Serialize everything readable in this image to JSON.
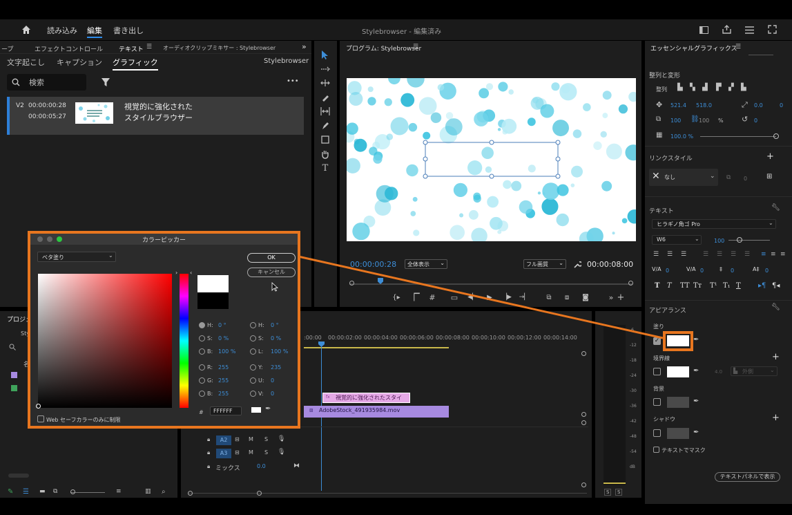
{
  "topbar": {
    "tabs": [
      "読み込み",
      "編集",
      "書き出し"
    ],
    "active_tab": "編集",
    "title": "Stylebrowser - 編集済み"
  },
  "left_panel": {
    "tabs": [
      "ープ",
      "エフェクトコントロール",
      "テキスト",
      "オーディオクリップミキサー : Stylebrowser"
    ],
    "subtabs": [
      "文字起こし",
      "キャプション",
      "グラフィック"
    ],
    "active_subtab": "グラフィック",
    "sequence": "Stylebrowser",
    "search_placeholder": "検索",
    "more": "•••",
    "clip": {
      "track": "V2",
      "in": "00:00:00:28",
      "out": "00:00:05:27",
      "title_line1": "視覚的に強化された",
      "title_line2": "スタイルブラウザー"
    }
  },
  "program": {
    "title": "プログラム: Stylebrowser",
    "menu_glyph": "☰",
    "timecode": "00:00:00:28",
    "fit": "全体表示",
    "quality": "フル画質",
    "duration": "00:00:08:00"
  },
  "timeline": {
    "ruler": [
      ":00:00",
      "00:00:02:00",
      "00:00:04:00",
      "00:00:06:00",
      "00:00:08:00",
      "00:00:10:00",
      "00:00:12:00",
      "00:00:14:00"
    ],
    "graphic_clip": "視覚的に強化されたスタイ",
    "video_clip": "AdobeStock_491935984.mov",
    "tracks": [
      "A2",
      "A3"
    ],
    "mix_label": "ミックス",
    "mix_value": "0.0",
    "meter": [
      "-6",
      "-12",
      "-18",
      "-24",
      "-30",
      "-36",
      "-42",
      "-48",
      "-54",
      "dB"
    ]
  },
  "project": {
    "tab": "プロジェ",
    "item": "Sty",
    "name_header": "名"
  },
  "essential": {
    "title": "エッセンシャルグラフィックス",
    "align_heading": "整列と変形",
    "align_label": "整列",
    "pos_x": "521.4",
    "pos_y": "518.0",
    "anchor_x": "0.0",
    "anchor_y": "0",
    "scale": "100",
    "scale2": "100",
    "scale_pct": "%",
    "rotation": "0",
    "opacity": "100.0 %",
    "link_style_heading": "リンクスタイル",
    "link_style_value": "なし",
    "link_style_count": "0",
    "text_heading": "テキスト",
    "font": "ヒラギノ角ゴ Pro",
    "weight": "W6",
    "size": "100",
    "tracking_values": [
      "0",
      "0",
      "0",
      "0"
    ],
    "appearance_heading": "アピアランス",
    "fill_label": "塗り",
    "stroke_label": "境界線",
    "stroke_width": "4.0",
    "stroke_type": "外側",
    "bg_label": "背景",
    "shadow_label": "シャドウ",
    "mask_label": "テキストでマスク",
    "footer_button": "テキストパネルで表示"
  },
  "color_picker": {
    "title": "カラーピッカー",
    "mode": "ベタ塗り",
    "ok": "OK",
    "cancel": "キャンセル",
    "h": "0 °",
    "s": "0 %",
    "b": "100 %",
    "h2": "0 °",
    "s2": "0 %",
    "l2": "100 %",
    "r": "255",
    "g": "255",
    "b_val": "255",
    "y": "235",
    "u": "0",
    "v": "0",
    "hex": "FFFFFF",
    "web_safe": "Web セーフカラーのみに制限"
  },
  "colors": {
    "accent": "#e8761f",
    "blue": "#3d8ed8",
    "selection": "#ffffff"
  }
}
